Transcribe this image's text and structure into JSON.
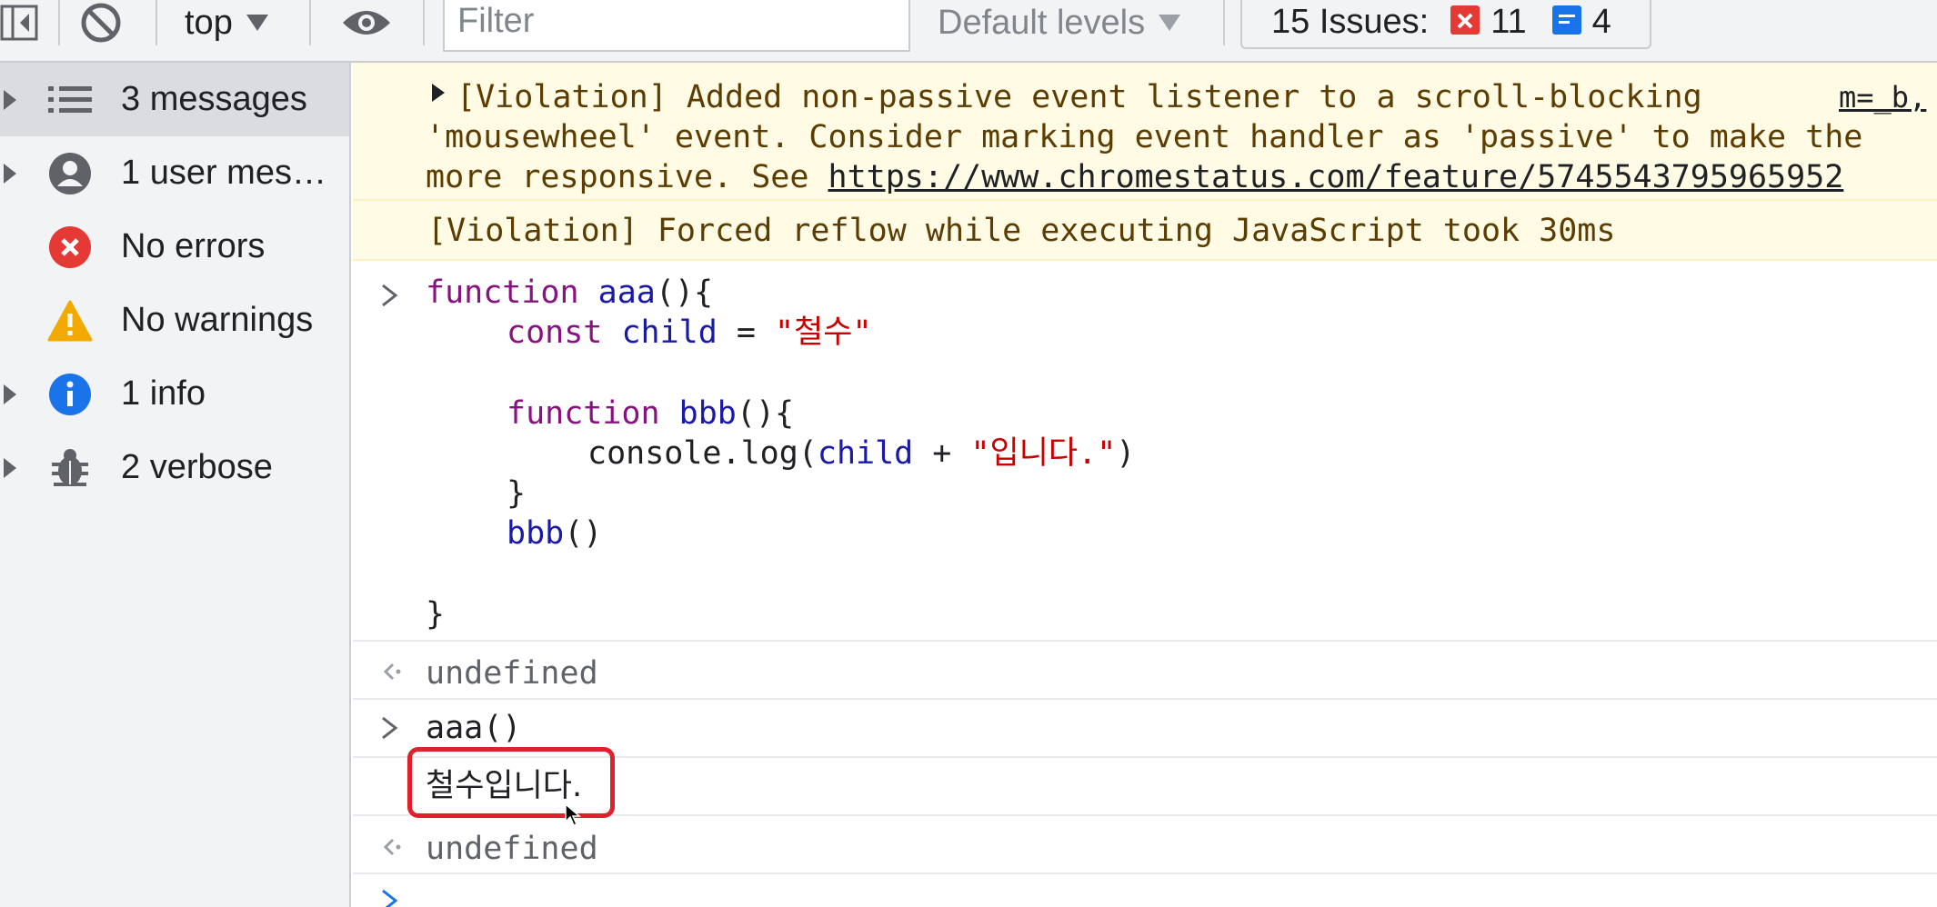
{
  "toolbar": {
    "context": "top",
    "filter_placeholder": "Filter",
    "levels": "Default levels",
    "issues_label": "15 Issues:",
    "errors_count": "11",
    "info_count": "4"
  },
  "sidebar": {
    "items": [
      {
        "label": "3 messages",
        "icon": "list-icon"
      },
      {
        "label": "1 user mes…",
        "icon": "user-icon"
      },
      {
        "label": "No errors",
        "icon": "error-icon"
      },
      {
        "label": "No warnings",
        "icon": "warning-icon"
      },
      {
        "label": "1 info",
        "icon": "info-icon"
      },
      {
        "label": "2 verbose",
        "icon": "bug-icon"
      }
    ]
  },
  "console": {
    "violation1": {
      "line1": "[Violation] Added non-passive event listener to a scroll-blocking",
      "source": "m=_b,",
      "line2": "'mousewheel' event. Consider marking event handler as 'passive' to make the",
      "line3_prefix": "more responsive. See ",
      "link": "https://www.chromestatus.com/feature/5745543795965952"
    },
    "violation2": "[Violation] Forced reflow while executing JavaScript took 30ms",
    "code": {
      "l1_kw": "function",
      "l1_name": "aaa",
      "l1_rest": "(){",
      "l2_kw": "const",
      "l2_var": "child",
      "l2_eq": " = ",
      "l2_str": "\"철수\"",
      "l4_kw": "function",
      "l4_name": "bbb",
      "l4_rest": "(){",
      "l5_obj": "console.log(",
      "l5_var": "child",
      "l5_op": " + ",
      "l5_str": "\"입니다.\"",
      "l5_end": ")",
      "l6": "}",
      "l7_name": "bbb",
      "l7_rest": "()",
      "l9": "}"
    },
    "result1": "undefined",
    "call": "aaa()",
    "output": "철수입니다.",
    "result2": "undefined"
  }
}
